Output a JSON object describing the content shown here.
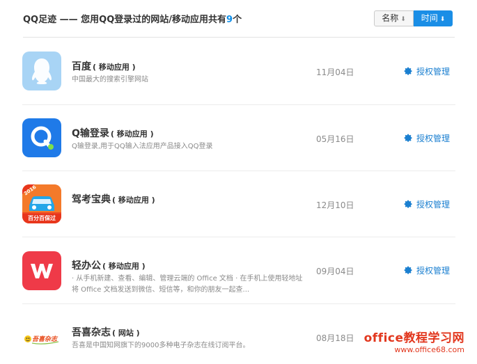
{
  "header": {
    "title_prefix": "QQ足迹 —— 您用QQ登录过的网站/移动应用共有",
    "count": "9",
    "title_suffix": "个"
  },
  "sort": {
    "name_label": "名称",
    "time_label": "时间",
    "arrow": "⬇"
  },
  "auth_label": "授权管理",
  "items": [
    {
      "name": "百度",
      "type": "( 移动应用 )",
      "desc": "中国最大的搜索引擎网站",
      "date": "11月04日",
      "icon": "qq-penguin-icon"
    },
    {
      "name": "Q输登录",
      "type": "( 移动应用 )",
      "desc": "Q输登录,用于QQ输入法应用产品接入QQ登录",
      "date": "05月16日",
      "icon": "q-input-icon"
    },
    {
      "name": "驾考宝典",
      "type": "( 移动应用 )",
      "desc": "",
      "date": "12月10日",
      "icon": "car-exam-icon",
      "badge_top": "2016",
      "badge_bottom": "百分百保过"
    },
    {
      "name": "轻办公",
      "type": "( 移动应用 )",
      "desc": "· 从手机新建、查看、编辑、管理云端的 Office 文档 · 在手机上使用轻地址将 Office 文档发送到微信、短信等，和你的朋友一起查...",
      "date": "09月04日",
      "icon": "wps-office-icon"
    },
    {
      "name": "吾喜杂志",
      "type": "( 网站 )",
      "desc": "吾喜是中国知网旗下的9000多种电子杂志在线订阅平台。",
      "date": "08月18日",
      "icon": "wuxi-magazine-icon",
      "logo_text": "吾喜杂志"
    }
  ],
  "watermark": {
    "main": "office教程学习网",
    "url": "www.office68.com"
  },
  "colors": {
    "accent": "#1a8ee6",
    "link": "#1a7fd0",
    "watermark": "#e2371e"
  }
}
